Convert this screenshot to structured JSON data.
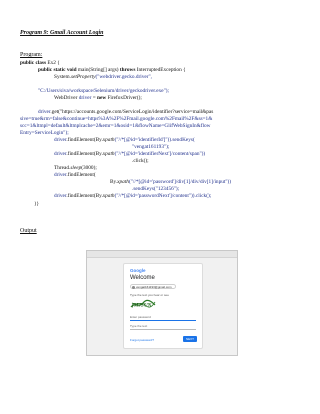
{
  "heading": "Program 9: Gmail Account Login",
  "program_label": "Program:",
  "code": {
    "l1_kw": "public class",
    "l1_rest": " Ex2 {",
    "l2_kw": "public static void",
    "l2_mid": " main(String[] args) ",
    "l2_kw2": "throws",
    "l2_rest": " InterruptedException {",
    "l3_a": "System.",
    "l3_it": "setProperty",
    "l3_b": "(\"webdriver.gecko.driver\",",
    "l4": "\"C:/Users/siva/workspace/Selenium/driver/geckodriver.exe\");",
    "l5_a": "WebDriver ",
    "l5_b": "driver",
    "l5_c": " = ",
    "l5_kw": "new",
    "l5_d": " FirefoxDriver();",
    "l6_a": "driver",
    "l6_b": ".get(\"https://accounts.google.com/ServiceLogin/identifier?service=mail&pas",
    "l7": "sive=true&rm=false&continue=https%3A%2F%2Fmail.google.com%2Fmail%2F&ss=1&",
    "l8": "scc=1&ltmpl=default&ltmplcache=2&emr=1&osid=1&flowName=GlifWebSignIn&flow",
    "l9": "Entry=ServiceLogin\");",
    "l10_a": "driver",
    "l10_b": ".findElement(By.",
    "l10_it": "xpath",
    "l10_c": "(\"//*[@id='identifierId']\")).sendKeys(",
    "l11": "\"vengat161193\");",
    "l12_a": "driver",
    "l12_b": ".findElement(By.",
    "l12_it": "xpath",
    "l12_c": "(\"//*[@id='identifierNext']/content/span\"))",
    "l13": ".click();",
    "l14_a": "Thread.",
    "l14_it": "sleep",
    "l14_b": "(3000);",
    "l15_a": "driver",
    "l15_b": ".findElement(",
    "l16_a": "By.",
    "l16_it": "xpath",
    "l16_b": "(\"//*[@id='password']/div[1]/div/div[1]/input\"))",
    "l17": ".sendKeys(\"123456\");",
    "l18_a": "driver",
    "l18_b": ".findElement(By.",
    "l18_it": "xpath",
    "l18_c": "(\"//*[@id='passwordNext']/content\")).click();",
    "l19": "}}"
  },
  "output_label": "Output",
  "screenshot": {
    "logo": "Google",
    "welcome": "Welcome",
    "account": "vengat161193@gmail.com",
    "subtitle": "Type the text you hear or see",
    "captcha_text": "fMJSUN",
    "field_placeholder": "Enter password",
    "field2_placeholder": "Type the text",
    "forgot": "Forgot password?",
    "next": "NEXT"
  },
  "colors": {
    "string": "#1f2f8c",
    "accent": "#1a73e8"
  }
}
